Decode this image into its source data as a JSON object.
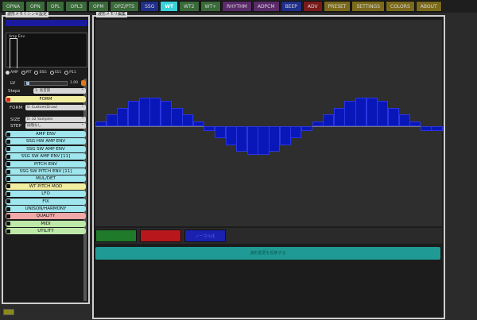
{
  "tabs": [
    {
      "label": "OPNA",
      "color": "#3a6a3a"
    },
    {
      "label": "OPN",
      "color": "#3a6a3a"
    },
    {
      "label": "OPL",
      "color": "#3a6a3a"
    },
    {
      "label": "OPL3",
      "color": "#3a6a3a"
    },
    {
      "label": "OPM",
      "color": "#3a6a3a"
    },
    {
      "label": "OPZ/PTS",
      "color": "#3a6a3a"
    },
    {
      "label": "SSG",
      "color": "#1f2f8a"
    },
    {
      "label": "WT",
      "color": "#3ad0d8",
      "active": true
    },
    {
      "label": "WT2",
      "color": "#3a6a3a"
    },
    {
      "label": "WT+",
      "color": "#3a6a3a"
    },
    {
      "label": "RHYTHM",
      "color": "#5a2a6a"
    },
    {
      "label": "ADPCM",
      "color": "#5a2a6a"
    },
    {
      "label": "BEEP",
      "color": "#1f2f8a"
    },
    {
      "label": "ADV",
      "color": "#7a1a1a"
    },
    {
      "label": "PRESET",
      "color": "#7a6a1a"
    },
    {
      "label": "SETTINGS",
      "color": "#7a6a1a"
    },
    {
      "label": "COLORS",
      "color": "#7a6a1a"
    },
    {
      "label": "ABOUT",
      "color": "#7a6a1a"
    }
  ],
  "left_panel": {
    "title": "波形メモリシンセ設定",
    "scope_label": "Amp Env",
    "scope_modes": [
      "AMP",
      "PIT",
      "SSG",
      "S11",
      "P11"
    ],
    "lv_label": "LV",
    "lv_value": "1.00",
    "steps_label": "Steps",
    "steps_value": "1: 高音質",
    "form_header": "FORM",
    "form_label": "FORM",
    "form_value": "0: Custom(Draw)",
    "size_label": "SIZE",
    "size_value": "0: 32 Samples",
    "step_label": "STEP",
    "step_value": "段階なし",
    "sections": [
      {
        "label": "AMP ENV",
        "color": "#9fe6ee"
      },
      {
        "label": "SSG HW AMP ENV",
        "color": "#9fe6ee"
      },
      {
        "label": "SSG SW AMP ENV",
        "color": "#9fe6ee"
      },
      {
        "label": "SSG SW AMP ENV [11]",
        "color": "#9fe6ee"
      },
      {
        "label": "PITCH ENV",
        "color": "#9fe6ee"
      },
      {
        "label": "SSG SW PITCH ENV [11]",
        "color": "#9fe6ee"
      },
      {
        "label": "MUL/DET",
        "color": "#9fe6ee"
      },
      {
        "label": "WT PITCH MOD",
        "color": "#f2eea0"
      },
      {
        "label": "LFO",
        "color": "#9fe6ee"
      },
      {
        "label": "FIX",
        "color": "#9fe6ee"
      },
      {
        "label": "UNISON/HARMONY",
        "color": "#9fe6ee"
      },
      {
        "label": "QUALITY",
        "color": "#f0a8a8"
      },
      {
        "label": "MIDI",
        "color": "#bde8a8"
      },
      {
        "label": "UTILITY",
        "color": "#bde8a8"
      }
    ]
  },
  "right_panel": {
    "title": "波形メモリ編集",
    "wave_bars": [
      1,
      3,
      5,
      7,
      8,
      8,
      7,
      5,
      3,
      1,
      -1,
      -3,
      -5,
      -7,
      -8,
      -8,
      -7,
      -5,
      -3,
      -1,
      1,
      3,
      5,
      7,
      8,
      8,
      7,
      5,
      3,
      1,
      -1,
      -1
    ],
    "buttons": [
      {
        "label": "",
        "color": "#1f7a2a"
      },
      {
        "label": "",
        "color": "#b8181c"
      },
      {
        "label": "ノーマル化",
        "color": "#1a20b0"
      }
    ],
    "apply_label": "波形変更を反映する",
    "apply_color": "#1f9a94"
  }
}
